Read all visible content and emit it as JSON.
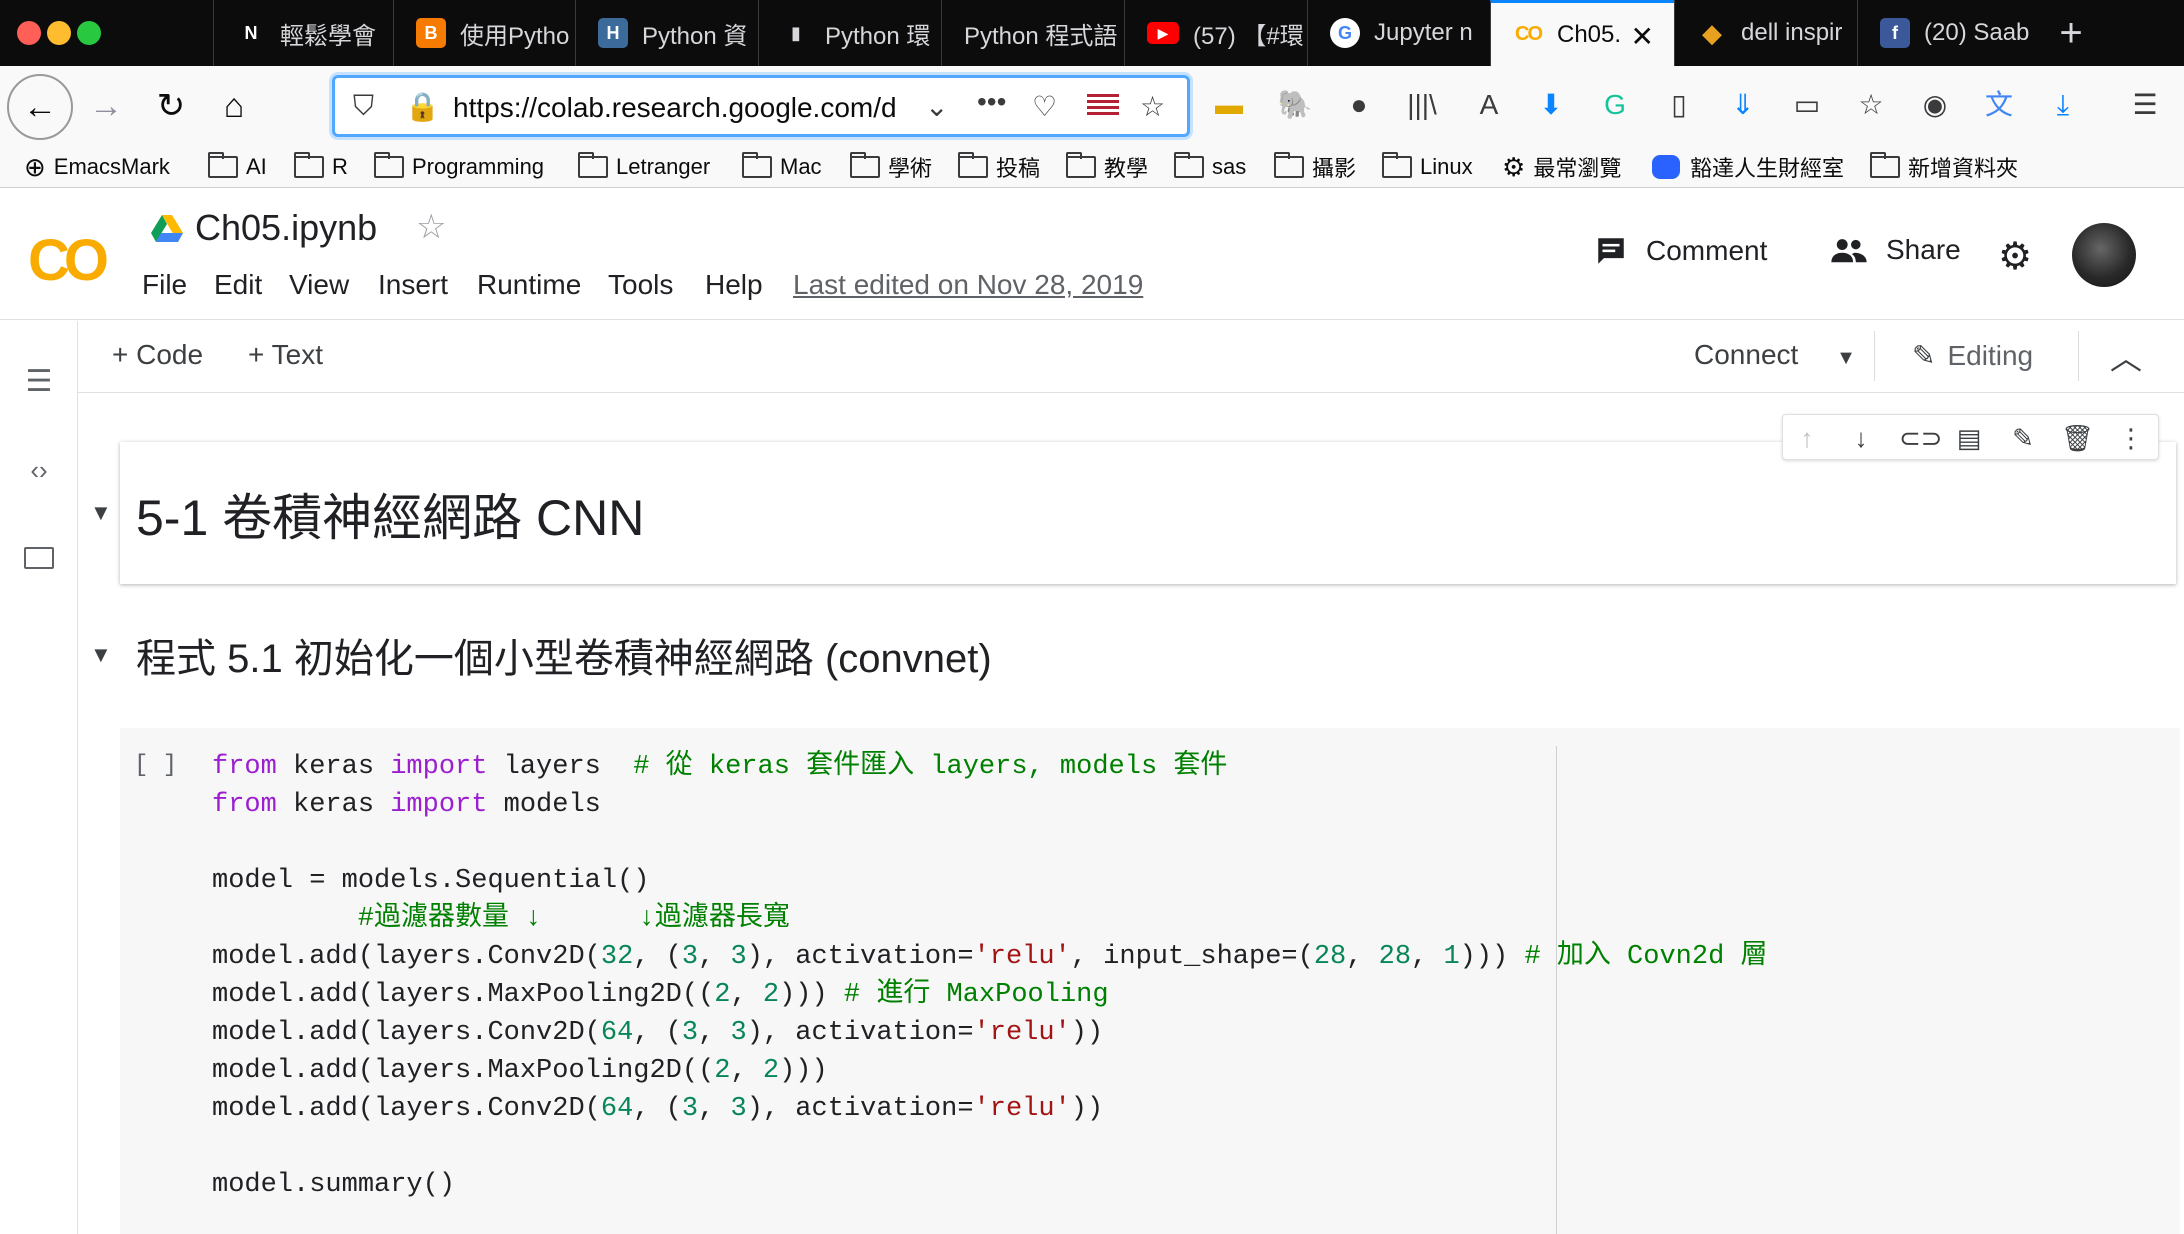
{
  "browser": {
    "tabs": [
      {
        "label": "輕鬆學會 ",
        "favicon": "N",
        "fav_bg": "#0c0c0d"
      },
      {
        "label": "使用Pytho",
        "favicon": "B",
        "fav_bg": "#f57c00"
      },
      {
        "label": "Python 資",
        "favicon": "H",
        "fav_bg": "#3b6a9b"
      },
      {
        "label": "Python 環",
        "favicon": "▮",
        "fav_bg": "#0c0c0d"
      },
      {
        "label": "Python 程式語",
        "favicon": "",
        "fav_bg": "#0c0c0d"
      },
      {
        "label": "(57) 【#環",
        "favicon": "▶",
        "fav_bg": "#ff0000"
      },
      {
        "label": "Jupyter n",
        "favicon": "G",
        "fav_bg": "#4285f4"
      },
      {
        "label": "Ch05.",
        "favicon": "CO",
        "fav_bg": "#f9f9fa",
        "active": true
      },
      {
        "label": "dell inspir",
        "favicon": "◆",
        "fav_bg": "#e8a020"
      },
      {
        "label": "(20) Saab",
        "favicon": "f",
        "fav_bg": "#3b5998"
      }
    ],
    "url": "https://colab.research.google.com/d",
    "bookmarks": [
      {
        "label": "EmacsMark",
        "icon": "globe-icon"
      },
      {
        "label": "AI",
        "icon": "folder-icon"
      },
      {
        "label": "R",
        "icon": "folder-icon"
      },
      {
        "label": "Programming",
        "icon": "folder-icon"
      },
      {
        "label": "Letranger",
        "icon": "folder-icon"
      },
      {
        "label": "Mac",
        "icon": "folder-icon"
      },
      {
        "label": "學術",
        "icon": "folder-icon"
      },
      {
        "label": "投稿",
        "icon": "folder-icon"
      },
      {
        "label": "教學",
        "icon": "folder-icon"
      },
      {
        "label": "sas",
        "icon": "folder-icon"
      },
      {
        "label": "攝影",
        "icon": "folder-icon"
      },
      {
        "label": "Linux",
        "icon": "folder-icon"
      },
      {
        "label": "最常瀏覽",
        "icon": "gear-icon"
      },
      {
        "label": "豁達人生財經室",
        "icon": "chat-bubble-icon"
      },
      {
        "label": "新增資料夾",
        "icon": "folder-icon"
      }
    ]
  },
  "colab": {
    "notebook_title": "Ch05.ipynb",
    "menus": [
      "File",
      "Edit",
      "View",
      "Insert",
      "Runtime",
      "Tools",
      "Help"
    ],
    "last_edited": "Last edited on Nov 28, 2019",
    "comment_label": "Comment",
    "share_label": "Share",
    "toolbar": {
      "code_label": "+ Code",
      "text_label": "+ Text",
      "connect_label": "Connect",
      "editing_label": "Editing"
    },
    "cells": {
      "heading1": "5-1 卷積神經網路 CNN",
      "heading2": "程式 5.1 初始化一個小型卷積神經網路 (convnet)",
      "run_bracket": "[ ]"
    }
  },
  "colors": {
    "accent": "#0a84ff",
    "colab_orange": "#f9ab00",
    "keyword": "#9c1fcf",
    "comment": "#008000",
    "string": "#a31515",
    "number": "#098658"
  }
}
